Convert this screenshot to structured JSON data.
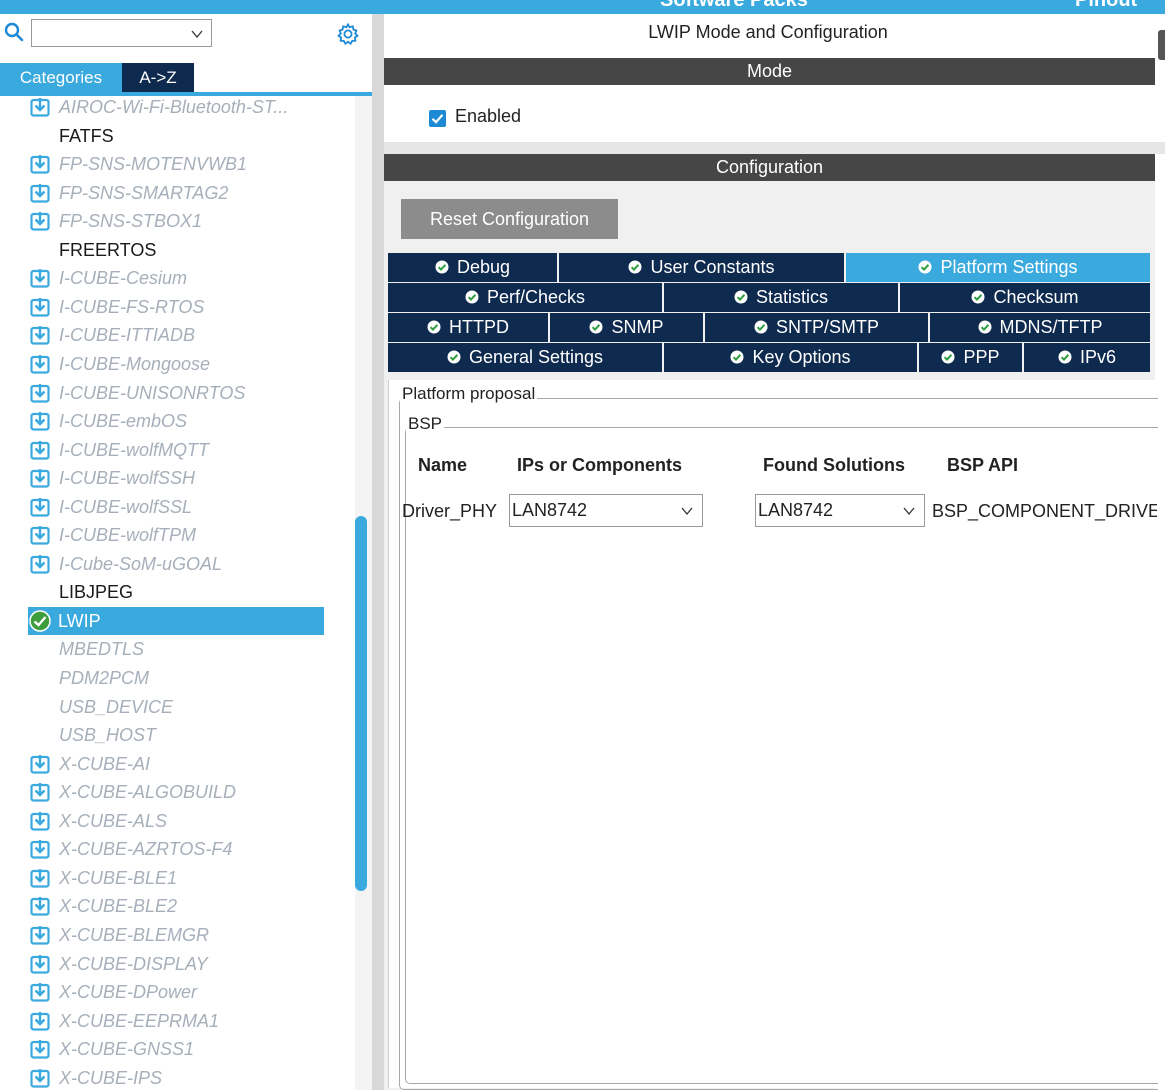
{
  "header": {
    "left_tab": "Software Packs",
    "right_tab": "Pinout",
    "accent": "#3aa9de"
  },
  "sidebar": {
    "search": {
      "value": "",
      "placeholder": ""
    },
    "tabs": [
      "Categories",
      "A->Z"
    ],
    "items": [
      {
        "label": "AIROC-Wi-Fi-Bluetooth-ST...",
        "kind": "pack"
      },
      {
        "label": "FATFS",
        "kind": "plain"
      },
      {
        "label": "FP-SNS-MOTENVWB1",
        "kind": "pack"
      },
      {
        "label": "FP-SNS-SMARTAG2",
        "kind": "pack"
      },
      {
        "label": "FP-SNS-STBOX1",
        "kind": "pack"
      },
      {
        "label": "FREERTOS",
        "kind": "plain"
      },
      {
        "label": "I-CUBE-Cesium",
        "kind": "pack"
      },
      {
        "label": "I-CUBE-FS-RTOS",
        "kind": "pack"
      },
      {
        "label": "I-CUBE-ITTIADB",
        "kind": "pack"
      },
      {
        "label": "I-CUBE-Mongoose",
        "kind": "pack"
      },
      {
        "label": "I-CUBE-UNISONRTOS",
        "kind": "pack"
      },
      {
        "label": "I-CUBE-embOS",
        "kind": "pack"
      },
      {
        "label": "I-CUBE-wolfMQTT",
        "kind": "pack"
      },
      {
        "label": "I-CUBE-wolfSSH",
        "kind": "pack"
      },
      {
        "label": "I-CUBE-wolfSSL",
        "kind": "pack"
      },
      {
        "label": "I-CUBE-wolfTPM",
        "kind": "pack"
      },
      {
        "label": "I-Cube-SoM-uGOAL",
        "kind": "pack"
      },
      {
        "label": "LIBJPEG",
        "kind": "plain"
      },
      {
        "label": "LWIP",
        "kind": "selected"
      },
      {
        "label": "MBEDTLS",
        "kind": "mw"
      },
      {
        "label": "PDM2PCM",
        "kind": "mw"
      },
      {
        "label": "USB_DEVICE",
        "kind": "mw"
      },
      {
        "label": "USB_HOST",
        "kind": "mw"
      },
      {
        "label": "X-CUBE-AI",
        "kind": "pack"
      },
      {
        "label": "X-CUBE-ALGOBUILD",
        "kind": "pack"
      },
      {
        "label": "X-CUBE-ALS",
        "kind": "pack"
      },
      {
        "label": "X-CUBE-AZRTOS-F4",
        "kind": "pack"
      },
      {
        "label": "X-CUBE-BLE1",
        "kind": "pack"
      },
      {
        "label": "X-CUBE-BLE2",
        "kind": "pack"
      },
      {
        "label": "X-CUBE-BLEMGR",
        "kind": "pack"
      },
      {
        "label": "X-CUBE-DISPLAY",
        "kind": "pack"
      },
      {
        "label": "X-CUBE-DPower",
        "kind": "pack"
      },
      {
        "label": "X-CUBE-EEPRMA1",
        "kind": "pack"
      },
      {
        "label": "X-CUBE-GNSS1",
        "kind": "pack"
      },
      {
        "label": "X-CUBE-IPS",
        "kind": "pack"
      }
    ]
  },
  "main": {
    "title": "LWIP Mode and Configuration",
    "mode_header": "Mode",
    "enabled_label": "Enabled",
    "enabled": true,
    "config_header": "Configuration",
    "reset_label": "Reset Configuration",
    "tabs": [
      [
        "Debug",
        "User Constants",
        "Platform Settings"
      ],
      [
        "Perf/Checks",
        "Statistics",
        "Checksum"
      ],
      [
        "HTTPD",
        "SNMP",
        "SNTP/SMTP",
        "MDNS/TFTP"
      ],
      [
        "General Settings",
        "Key Options",
        "PPP",
        "IPv6"
      ]
    ],
    "active_tab": "Platform Settings",
    "platform_legend": "Platform proposal",
    "bsp_legend": "BSP",
    "table": {
      "headers": [
        "Name",
        "IPs or Components",
        "Found Solutions",
        "BSP API"
      ],
      "rows": [
        {
          "name": "Driver_PHY",
          "ip": "LAN8742",
          "solution": "LAN8742",
          "api": "BSP_COMPONENT_DRIVER"
        }
      ]
    }
  }
}
